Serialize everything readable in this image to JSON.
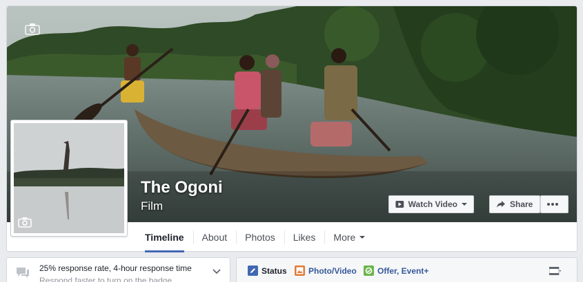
{
  "page": {
    "name": "The Ogoni",
    "category": "Film"
  },
  "icons": {
    "cover_camera": "camera-icon",
    "profile_camera": "camera-icon",
    "watch": "video-play-icon",
    "share": "share-arrow-icon",
    "more": "more-dots-icon",
    "response": "chat-bubble-icon",
    "status": "pencil-icon",
    "photo": "photo-icon",
    "offer": "offer-icon"
  },
  "actions": {
    "watch_video": "Watch Video",
    "share": "Share"
  },
  "tabs": [
    {
      "label": "Timeline",
      "active": true
    },
    {
      "label": "About"
    },
    {
      "label": "Photos"
    },
    {
      "label": "Likes"
    },
    {
      "label": "More"
    }
  ],
  "response": {
    "main": "25% response rate, 4-hour response time",
    "sub": "Respond faster to turn on the badge"
  },
  "composer": {
    "status": "Status",
    "photo_video": "Photo/Video",
    "offer_event": "Offer, Event+"
  },
  "colors": {
    "accent": "#4267b2",
    "link": "#365899"
  }
}
